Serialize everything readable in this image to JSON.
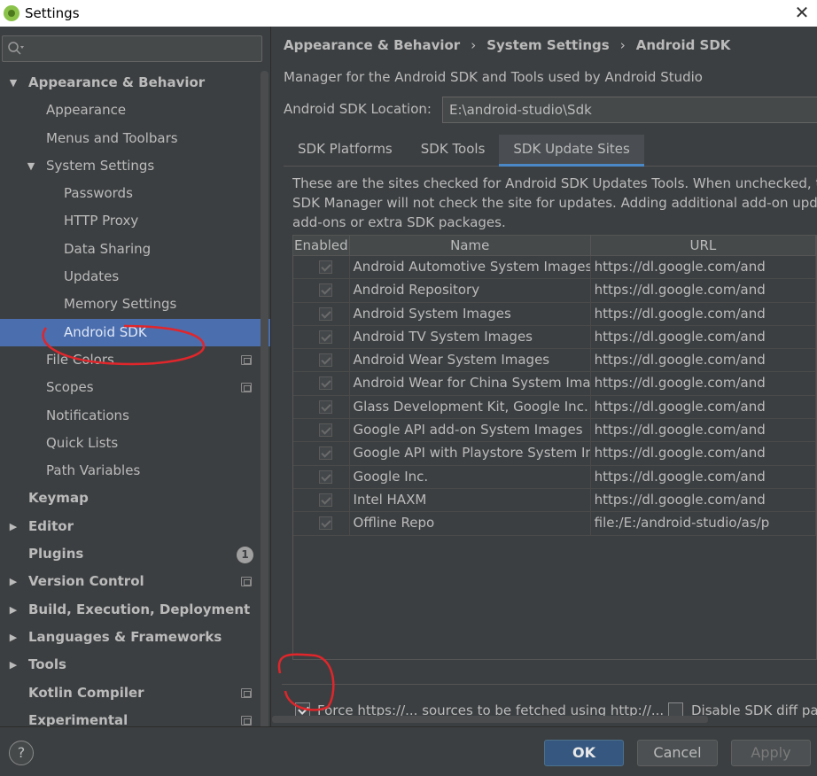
{
  "window": {
    "title": "Settings",
    "close_glyph": "✕"
  },
  "sidebar": {
    "search": {
      "value": "",
      "placeholder": ""
    },
    "items": [
      {
        "label": "Appearance & Behavior",
        "level": 0,
        "bold": true,
        "arrow": "▼"
      },
      {
        "label": "Appearance",
        "level": 1
      },
      {
        "label": "Menus and Toolbars",
        "level": 1
      },
      {
        "label": "System Settings",
        "level": 1,
        "arrow": "▼"
      },
      {
        "label": "Passwords",
        "level": 2
      },
      {
        "label": "HTTP Proxy",
        "level": 2
      },
      {
        "label": "Data Sharing",
        "level": 2
      },
      {
        "label": "Updates",
        "level": 2
      },
      {
        "label": "Memory Settings",
        "level": 2
      },
      {
        "label": "Android SDK",
        "level": 2,
        "selected": true
      },
      {
        "label": "File Colors",
        "level": 1,
        "icon": "copy-icon"
      },
      {
        "label": "Scopes",
        "level": 1,
        "icon": "copy-icon"
      },
      {
        "label": "Notifications",
        "level": 1
      },
      {
        "label": "Quick Lists",
        "level": 1
      },
      {
        "label": "Path Variables",
        "level": 1
      },
      {
        "label": "Keymap",
        "level": 0,
        "bold": true
      },
      {
        "label": "Editor",
        "level": 0,
        "bold": true,
        "arrow": "▶"
      },
      {
        "label": "Plugins",
        "level": 0,
        "bold": true,
        "badge": "1"
      },
      {
        "label": "Version Control",
        "level": 0,
        "bold": true,
        "arrow": "▶",
        "icon": "copy-icon"
      },
      {
        "label": "Build, Execution, Deployment",
        "level": 0,
        "bold": true,
        "arrow": "▶"
      },
      {
        "label": "Languages & Frameworks",
        "level": 0,
        "bold": true,
        "arrow": "▶"
      },
      {
        "label": "Tools",
        "level": 0,
        "bold": true,
        "arrow": "▶"
      },
      {
        "label": "Kotlin Compiler",
        "level": 0,
        "bold": true,
        "icon": "copy-icon"
      },
      {
        "label": "Experimental",
        "level": 0,
        "bold": true,
        "icon": "copy-icon"
      }
    ]
  },
  "main": {
    "breadcrumb": [
      "Appearance & Behavior",
      "System Settings",
      "Android SDK"
    ],
    "breadcrumb_sep": "›",
    "description": "Manager for the Android SDK and Tools used by Android Studio",
    "sdk_location_label": "Android SDK Location:",
    "sdk_location_value": "E:\\android-studio\\Sdk",
    "tabs": [
      {
        "label": "SDK Platforms",
        "active": false
      },
      {
        "label": "SDK Tools",
        "active": false
      },
      {
        "label": "SDK Update Sites",
        "active": true
      }
    ],
    "info_lines": [
      "These are the sites checked for Android SDK Updates Tools. When unchecked, the",
      "SDK Manager will not check the site for updates. Adding additional add-on updat",
      "add-ons or extra SDK packages."
    ],
    "table": {
      "headers": [
        "Enabled",
        "Name",
        "URL"
      ],
      "rows": [
        {
          "enabled": true,
          "name": "Android Automotive System Images",
          "url": "https://dl.google.com/and"
        },
        {
          "enabled": true,
          "name": "Android Repository",
          "url": "https://dl.google.com/and"
        },
        {
          "enabled": true,
          "name": "Android System Images",
          "url": "https://dl.google.com/and"
        },
        {
          "enabled": true,
          "name": "Android TV System Images",
          "url": "https://dl.google.com/and"
        },
        {
          "enabled": true,
          "name": "Android Wear System Images",
          "url": "https://dl.google.com/and"
        },
        {
          "enabled": true,
          "name": "Android Wear for China System Images",
          "url": "https://dl.google.com/and"
        },
        {
          "enabled": true,
          "name": "Glass Development Kit, Google Inc.",
          "url": "https://dl.google.com/and"
        },
        {
          "enabled": true,
          "name": "Google API add-on System Images",
          "url": "https://dl.google.com/and"
        },
        {
          "enabled": true,
          "name": "Google API with Playstore System Images",
          "url": "https://dl.google.com/and"
        },
        {
          "enabled": true,
          "name": "Google Inc.",
          "url": "https://dl.google.com/and"
        },
        {
          "enabled": true,
          "name": "Intel HAXM",
          "url": "https://dl.google.com/and"
        },
        {
          "enabled": true,
          "name": "Offline Repo",
          "url": "file:/E:/android-studio/as/p"
        }
      ]
    },
    "force_https": {
      "label": "Force https://... sources to be fetched using http://...",
      "checked": true
    },
    "disable_diff": {
      "label": "Disable SDK diff pat",
      "checked": false
    }
  },
  "footer": {
    "help_glyph": "?",
    "ok_label": "OK",
    "cancel_label": "Cancel",
    "apply_label": "Apply"
  },
  "colors": {
    "selection": "#4b6eaf",
    "ok_button": "#365880",
    "annotation": "#e0262b"
  }
}
